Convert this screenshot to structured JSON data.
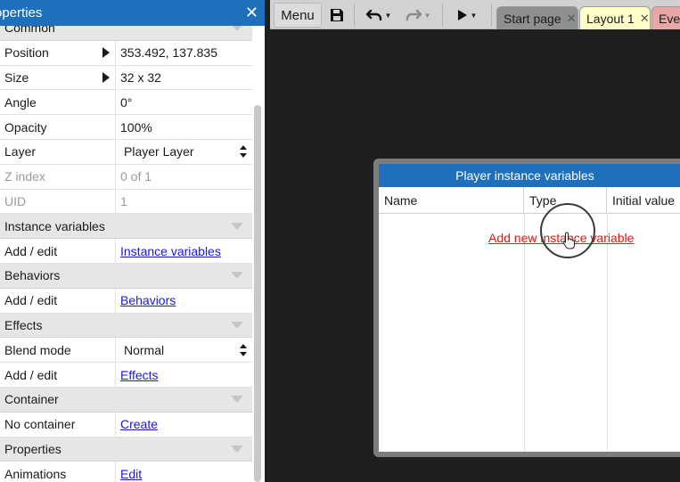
{
  "panel": {
    "title": "operties",
    "close_glyph": "✕",
    "rows": [
      {
        "type": "section",
        "label": "Common"
      },
      {
        "type": "expand",
        "key": "Position",
        "value": "353.492, 137.835"
      },
      {
        "type": "expand",
        "key": "Size",
        "value": "32 x 32"
      },
      {
        "type": "plain",
        "key": "Angle",
        "value": "0°"
      },
      {
        "type": "plain",
        "key": "Opacity",
        "value": "100%"
      },
      {
        "type": "select",
        "key": "Layer",
        "value": "Player Layer"
      },
      {
        "type": "dim",
        "key": "Z index",
        "value": "0 of 1"
      },
      {
        "type": "dim",
        "key": "UID",
        "value": "1"
      },
      {
        "type": "section",
        "label": "Instance variables"
      },
      {
        "type": "link",
        "key": "Add / edit",
        "value": "Instance variables"
      },
      {
        "type": "section",
        "label": "Behaviors"
      },
      {
        "type": "link",
        "key": "Add / edit",
        "value": "Behaviors"
      },
      {
        "type": "section",
        "label": "Effects"
      },
      {
        "type": "select",
        "key": "Blend mode",
        "value": "Normal"
      },
      {
        "type": "link",
        "key": "Add / edit",
        "value": "Effects"
      },
      {
        "type": "section",
        "label": "Container"
      },
      {
        "type": "link",
        "key": "No container",
        "value": "Create"
      },
      {
        "type": "section",
        "label": "Properties"
      },
      {
        "type": "link",
        "key": "Animations",
        "value": "Edit"
      }
    ]
  },
  "toolbar": {
    "menu_label": "Menu",
    "icons": [
      "save-icon",
      "undo-icon",
      "redo-icon",
      "play-icon"
    ],
    "tabs": [
      {
        "label": "Start page",
        "close": "✕",
        "bg": "#8f8f8f",
        "color": "#1a1a1a"
      },
      {
        "label": "Layout 1",
        "close": "✕",
        "bg": "#ffffc8",
        "color": "#1a1a1a"
      },
      {
        "label": "Ever",
        "close": "",
        "bg": "#e8a7a7",
        "color": "#1a1a1a"
      }
    ]
  },
  "dialog": {
    "title": "Player instance variables",
    "columns": [
      "Name",
      "Type",
      "Initial value"
    ],
    "add_link": "Add new instance variable"
  },
  "colors": {
    "accent_blue": "#1d70b9",
    "link_blue": "#1a1ad6",
    "link_red": "#e01515",
    "canvas": "#1f1f1f"
  }
}
